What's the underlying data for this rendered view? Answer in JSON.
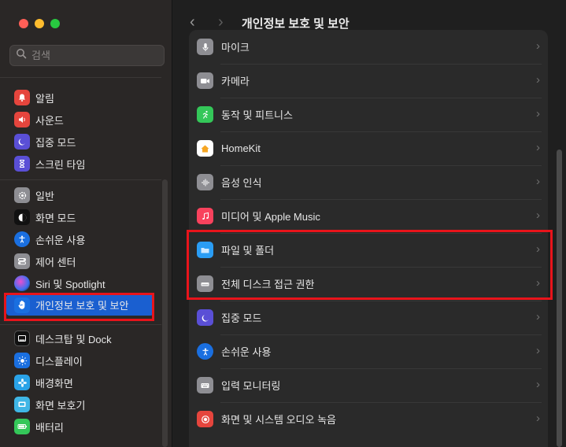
{
  "search": {
    "placeholder": "검색"
  },
  "sidebar": {
    "group1": [
      {
        "label": "알림",
        "icon": "bell-icon",
        "color": "#e5453d"
      },
      {
        "label": "사운드",
        "icon": "speaker-icon",
        "color": "#e5453d"
      },
      {
        "label": "집중 모드",
        "icon": "moon-icon",
        "color": "#5a4fd6"
      },
      {
        "label": "스크린 타임",
        "icon": "hourglass-icon",
        "color": "#5a4fd6"
      }
    ],
    "group2": [
      {
        "label": "일반",
        "icon": "gear-icon",
        "color": "#8e8e93"
      },
      {
        "label": "화면 모드",
        "icon": "appearance-icon",
        "color": "#111111"
      },
      {
        "label": "손쉬운 사용",
        "icon": "accessibility-icon",
        "color": "#1a6fe0"
      },
      {
        "label": "제어 센터",
        "icon": "control-center-icon",
        "color": "#8e8e93"
      },
      {
        "label": "Siri 및 Spotlight",
        "icon": "siri-icon",
        "color": "#2a2a2a"
      },
      {
        "label": "개인정보 보호 및 보안",
        "icon": "hand-icon",
        "color": "#1a6fe0",
        "active": true
      }
    ],
    "group3": [
      {
        "label": "데스크탑 및 Dock",
        "icon": "dock-icon",
        "color": "#111111"
      },
      {
        "label": "디스플레이",
        "icon": "sun-icon",
        "color": "#1a6fe0"
      },
      {
        "label": "배경화면",
        "icon": "flower-icon",
        "color": "#2aa3e8"
      },
      {
        "label": "화면 보호기",
        "icon": "screensaver-icon",
        "color": "#3fb6e6"
      },
      {
        "label": "배터리",
        "icon": "battery-icon",
        "color": "#34c759"
      }
    ]
  },
  "header": {
    "title": "개인정보 보호 및 보안",
    "back": "‹",
    "forward": "›"
  },
  "main": {
    "items": [
      {
        "label": "마이크",
        "icon": "microphone-icon",
        "color": "#8e8e93"
      },
      {
        "label": "카메라",
        "icon": "camera-icon",
        "color": "#8e8e93"
      },
      {
        "label": "동작 및 피트니스",
        "icon": "fitness-icon",
        "color": "#34c759"
      },
      {
        "label": "HomeKit",
        "icon": "home-icon",
        "color": "#ffffff"
      },
      {
        "label": "음성 인식",
        "icon": "waveform-icon",
        "color": "#8e8e93"
      },
      {
        "label": "미디어 및 Apple Music",
        "icon": "music-icon",
        "color": "#f9425d"
      },
      {
        "label": "파일 및 폴더",
        "icon": "folder-icon",
        "color": "#2a9df4"
      },
      {
        "label": "전체 디스크 접근 권한",
        "icon": "disk-icon",
        "color": "#8e8e93"
      },
      {
        "label": "집중 모드",
        "icon": "moon-icon",
        "color": "#5a4fd6"
      },
      {
        "label": "손쉬운 사용",
        "icon": "accessibility-icon",
        "color": "#1a6fe0"
      },
      {
        "label": "입력 모니터링",
        "icon": "keyboard-icon",
        "color": "#8e8e93"
      },
      {
        "label": "화면 및 시스템 오디오 녹음",
        "icon": "record-icon",
        "color": "#e5453d"
      }
    ]
  }
}
